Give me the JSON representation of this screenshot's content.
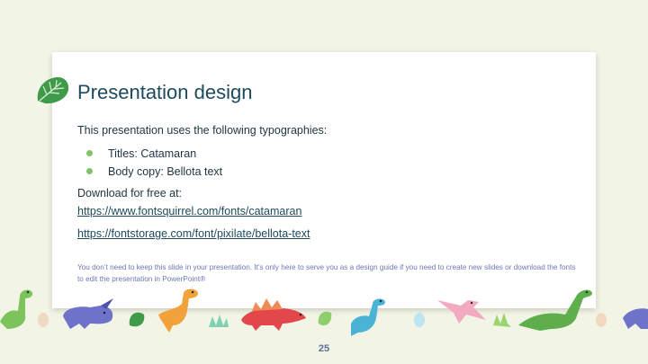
{
  "slide": {
    "title": "Presentation design",
    "intro": "This presentation uses the following typographies:",
    "bullets": [
      "Titles: Catamaran",
      "Body copy: Bellota text"
    ],
    "download_label": "Download for free at:",
    "links": [
      "https://www.fontsquirrel.com/fonts/catamaran",
      "https://fontstorage.com/font/pixilate/bellota-text"
    ],
    "note": "You don’t need to keep this slide in your presentation. It’s only here to serve you as a design guide if you need to create new slides or download the fonts to edit the presentation in PowerPoint®",
    "page_number": "25"
  },
  "colors": {
    "background": "#f2f5e6",
    "title": "#1d4a5c",
    "bullet": "#82c36a",
    "note": "#6b79b0"
  }
}
